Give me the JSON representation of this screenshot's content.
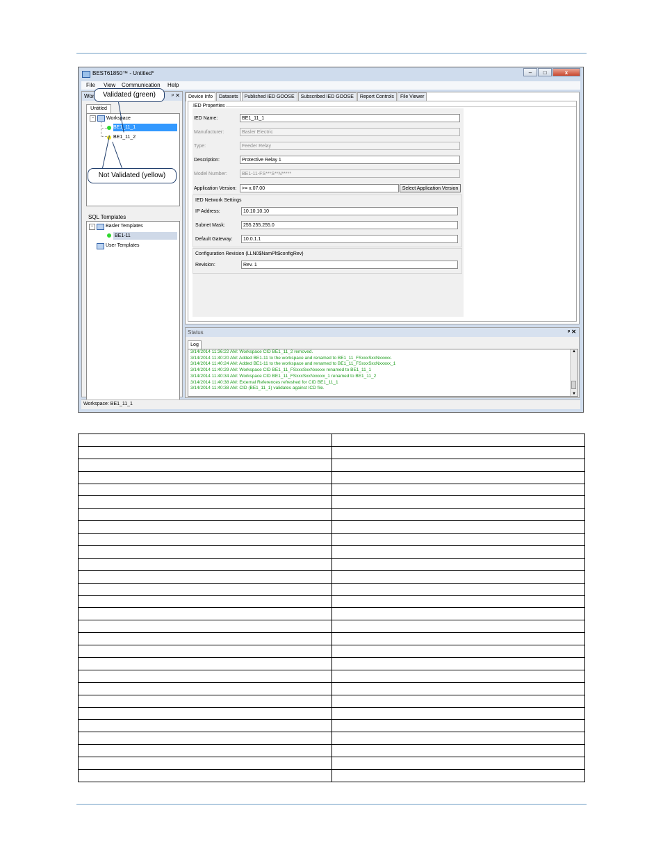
{
  "window": {
    "title": "BEST61850™ - Untitled*",
    "min_label": "–",
    "max_label": "□",
    "close_label": "x"
  },
  "menu": {
    "file": "File",
    "view": "View",
    "communication": "Communication",
    "help": "Help"
  },
  "workspace_panel": {
    "header": "Wor",
    "pin_close": "ᵖ ✕",
    "tab": "Untitled",
    "root": "Workspace",
    "items": [
      "BE1_11_1",
      "BE1_11_2"
    ]
  },
  "sql_templates": {
    "label": "SQL Templates",
    "basler": "Basler Templates",
    "basler_child": "BE1-11",
    "user": "User Templates"
  },
  "callouts": {
    "validated": "Validated (green)",
    "not_validated": "Not Validated (yellow)"
  },
  "tabs": [
    "Device Info",
    "Datasets",
    "Published IED GOOSE",
    "Subscribed IED GOOSE",
    "Report Controls",
    "File Viewer"
  ],
  "ied_properties": {
    "group_label": "IED Properties",
    "ied_name_label": "IED Name:",
    "ied_name": "BE1_11_1",
    "manufacturer_label": "Manufacturer:",
    "manufacturer": "Basler Electric",
    "type_label": "Type:",
    "type": "Feeder Relay",
    "description_label": "Description:",
    "description": "Protective Relay 1",
    "model_label": "Model Number:",
    "model": "BE1-11-FS***S**N*****",
    "app_version_label": "Application Version:",
    "app_version": ">= x.07.00",
    "select_app_version": "Select Application Version"
  },
  "network": {
    "group_label": "IED Network Settings",
    "ip_label": "IP Address:",
    "ip": "10.10.10.10",
    "subnet_label": "Subnet Mask:",
    "subnet": "255.255.255.0",
    "gateway_label": "Default Gateway:",
    "gateway": "10.0.1.1"
  },
  "config_revision": {
    "group_label": "Configuration Revision (LLN0$NamPlt$configRev)",
    "revision_label": "Revision:",
    "revision": "Rev. 1"
  },
  "status": {
    "header": "Status",
    "controls": "ᵖ ✕",
    "log_tab": "Log",
    "log": [
      "3/14/2014 11:36:22 AM: Workspace CID BE1_11_2 removed.",
      "3/14/2014 11:40:20 AM: Added BE1-11 to the workspace and renamed to BE1_11_FSxxxSxxNxxxxx.",
      "3/14/2014 11:40:24 AM: Added BE1-11 to the workspace and renamed to BE1_11_FSxxxSxxNxxxxx_1",
      "3/14/2014 11:40:29 AM: Workspace CID BE1_11_FSxxxSxxNxxxxx renamed to BE1_11_1",
      "3/14/2014 11:40:34 AM: Workspace CID BE1_11_FSxxxSxxNxxxxx_1 renamed to BE1_11_2",
      "3/14/2014 11:40:38 AM: External References refreshed for CID BE1_11_1",
      "3/14/2014 11:40:38 AM: CID (BE1_11_1) validates against ICD file."
    ]
  },
  "statusbar": "Workspace: BE1_11_1",
  "colors": {
    "accent_rule": "#6c9bc4",
    "log_text": "#1d9c1d",
    "selection": "#3399ff",
    "validated": "#2ed82e",
    "not_validated": "#f0e020"
  },
  "blank_table_rows": 28
}
